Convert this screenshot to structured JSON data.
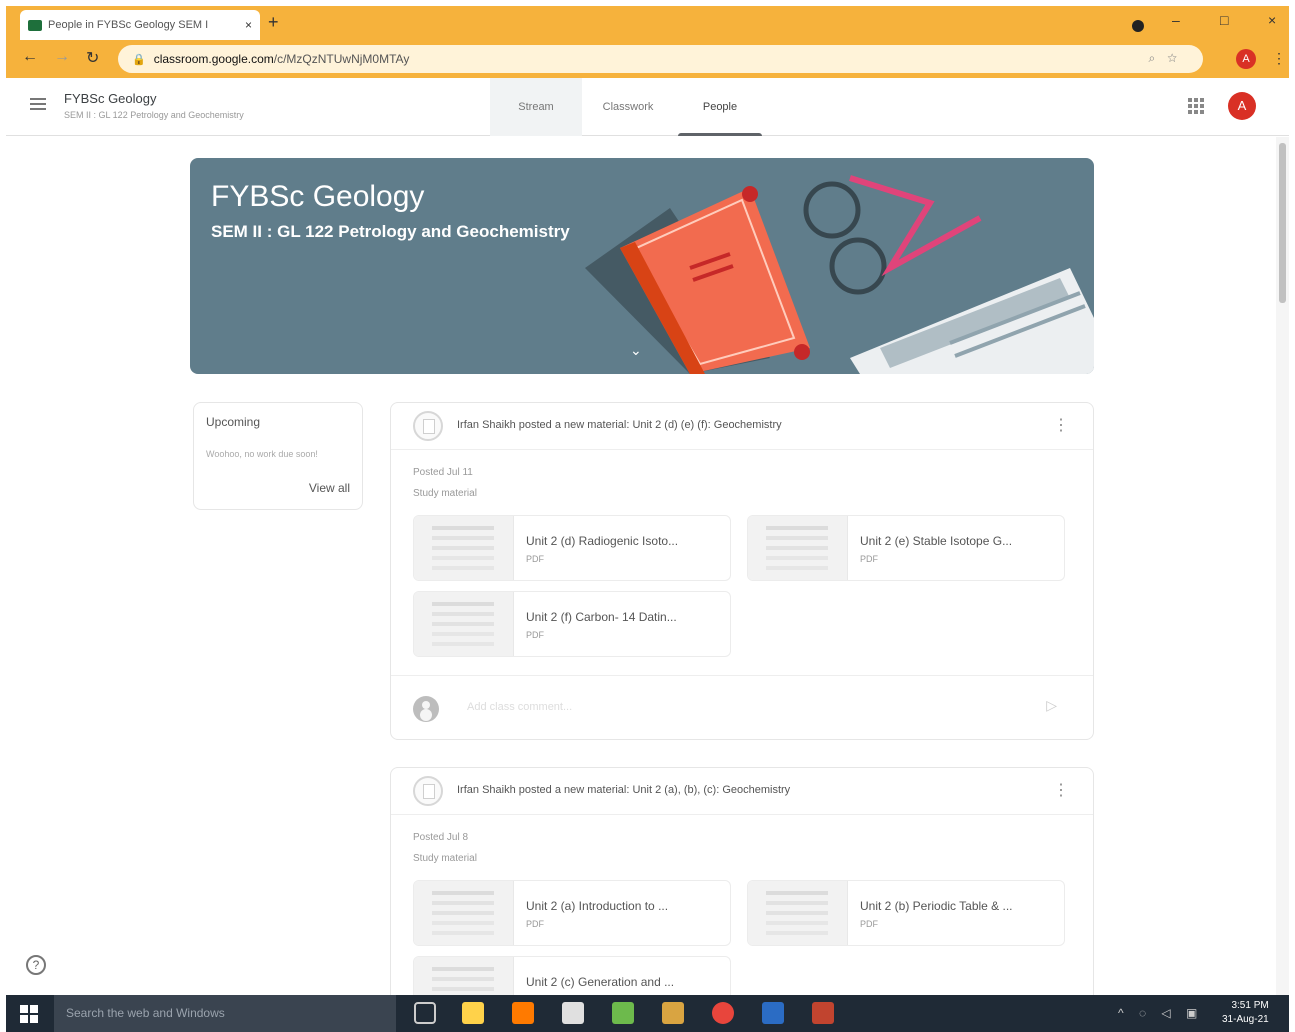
{
  "browser": {
    "tab_title": "People in FYBSc Geology SEM I",
    "tab_close": "×",
    "new_tab": "+",
    "url_host": "classroom.google.com",
    "url_path": "/c/MzQzNTUwNjM0MTAy",
    "profile_initial": "A",
    "menu": "⋮",
    "minimize": "–",
    "maximize": "□",
    "close": "×"
  },
  "header": {
    "course_title": "FYBSc Geology",
    "course_subtitle": "SEM II : GL 122 Petrology and Geochemistry",
    "tabs": [
      {
        "label": "Stream"
      },
      {
        "label": "Classwork"
      },
      {
        "label": "People"
      }
    ],
    "avatar_initial": "A"
  },
  "banner": {
    "title": "FYBSc Geology",
    "subtitle": "SEM II : GL 122 Petrology and Geochemistry",
    "colors": {
      "background": "#607d8b",
      "book": "#f26b4f",
      "glasses": "#e0447a"
    }
  },
  "upcoming": {
    "title": "Upcoming",
    "empty_text": "Woohoo, no work due soon!",
    "view_all": "View all"
  },
  "posts": [
    {
      "author_text": "Irfan Shaikh posted a new material: Unit 2 (d) (e) (f): Geochemistry",
      "date": "Posted Jul 11",
      "kind": "Study material",
      "attachments": [
        {
          "name": "Unit 2 (d) Radiogenic Isoto...",
          "type": "PDF"
        },
        {
          "name": "Unit 2 (e) Stable Isotope G...",
          "type": "PDF"
        },
        {
          "name": "Unit 2 (f) Carbon- 14 Datin...",
          "type": "PDF"
        }
      ],
      "comment_placeholder": "Add class comment..."
    },
    {
      "author_text": "Irfan Shaikh posted a new material: Unit 2 (a), (b), (c): Geochemistry",
      "date": "Posted Jul 8",
      "kind": "Study material",
      "attachments": [
        {
          "name": "Unit 2 (a) Introduction to ...",
          "type": "PDF"
        },
        {
          "name": "Unit 2 (b) Periodic Table & ...",
          "type": "PDF"
        },
        {
          "name": "Unit 2 (c) Generation and ...",
          "type": ""
        }
      ]
    }
  ],
  "help": "?",
  "taskbar": {
    "search_placeholder": "Search the web and Windows",
    "time": "3:51 PM",
    "date": "31-Aug-21",
    "icon_colors": [
      "#ffd24a",
      "#ff7a00",
      "#e0e0e0",
      "#6dba4c",
      "#d9a441",
      "#e8453c",
      "#2b6cc4",
      "#c1442f"
    ]
  }
}
